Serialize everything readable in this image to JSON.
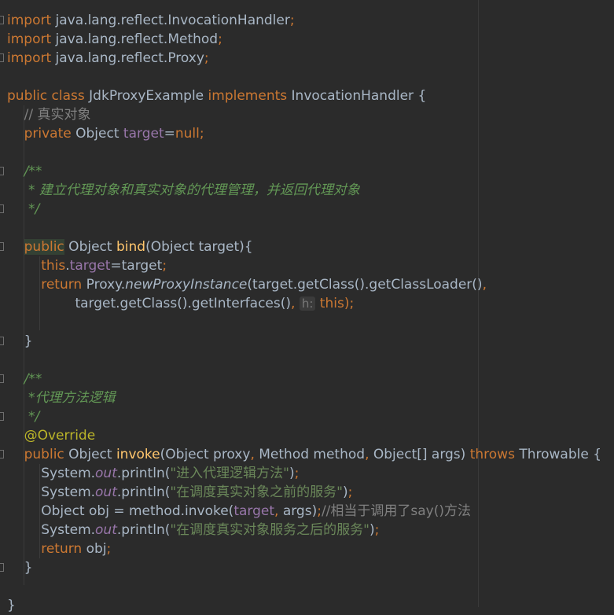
{
  "code": {
    "l1_kw": "import",
    "l1_pkg": " java.lang.reflect.InvocationHandler",
    "l2_kw": "import",
    "l2_pkg": " java.lang.reflect.Method",
    "l3_kw": "import",
    "l3_pkg": " java.lang.reflect.Proxy",
    "semicolon": ";",
    "l5_kw": "public class",
    "l5_name": " JdkProxyExample ",
    "l5_impl": "implements",
    "l5_iface": " InvocationHandler {",
    "l6_comment": "    // 真实对象",
    "l7_kw": "    private",
    "l7_type": " Object ",
    "l7_field": "target",
    "l7_eq": "=",
    "l7_null": "null",
    "l9_doc": "    /**",
    "l10_doc": "     * 建立代理对象和真实对象的代理管理，并返回代理对象",
    "l11_doc": "     */",
    "l13_indent": "    ",
    "l13_kw": "public",
    "l13_type": " Object ",
    "l13_fn": "bind",
    "l13_params": "(Object target){",
    "l14_this": "        this",
    "l14_dot": ".",
    "l14_field": "target",
    "l14_rest": "=target",
    "l15_kw": "        return",
    "l15_proxy": " Proxy.",
    "l15_method": "newProxyInstance",
    "l15_rest": "(target.getClass().getClassLoader()",
    "comma": ",",
    "l16_rest": "                target.getClass().getInterfaces()",
    "l16_hint": "h:",
    "l16_this": "this",
    "l16_end": ");",
    "l18_brace": "    }",
    "l20_doc": "    /**",
    "l21_doc": "     *代理方法逻辑",
    "l22_doc": "     */",
    "l23_ann": "    @Override",
    "l24_kw": "    public",
    "l24_type": " Object ",
    "l24_fn": "invoke",
    "l24_params": "(Object proxy",
    "l24_method": " Method method",
    "l24_args": " Object[] args) ",
    "l24_throws": "throws",
    "l24_throwable": " Throwable {",
    "sys": "        System.",
    "out": "out",
    "println": ".println(",
    "l25_str": "\"进入代理逻辑方法\"",
    "l26_str": "\"在调度真实对象之前的服务\"",
    "l27_start": "        Object obj = method.invoke(",
    "l27_target": "target",
    "l27_args": " args)",
    "l27_comment": "//相当于调用了say()方法",
    "l28_str": "\"在调度真实对象服务之后的服务\"",
    "paren_semi": ")",
    "l29_kw": "        return",
    "l29_rest": " obj",
    "l30_brace": "    }",
    "l32_brace": "}"
  }
}
